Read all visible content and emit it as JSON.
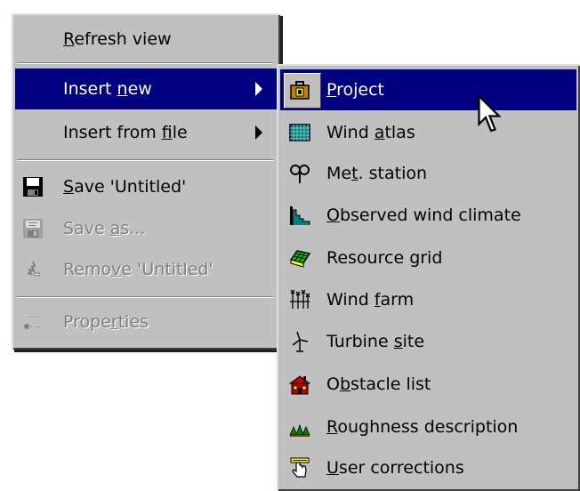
{
  "main_menu": {
    "items": [
      {
        "label_pre": "",
        "label_key": "R",
        "label_post": "efresh view"
      },
      {
        "label_pre": "Insert ",
        "label_key": "n",
        "label_post": "ew"
      },
      {
        "label_pre": "Insert from ",
        "label_key": "f",
        "label_post": "ile"
      },
      {
        "label_pre": "",
        "label_key": "S",
        "label_post": "ave 'Untitled'"
      },
      {
        "label_pre": "Save ",
        "label_key": "a",
        "label_post": "s..."
      },
      {
        "label_pre": "Remo",
        "label_key": "v",
        "label_post": "e 'Untitled'"
      },
      {
        "label_pre": "Prope",
        "label_key": "r",
        "label_post": "ties"
      }
    ]
  },
  "submenu": {
    "items": [
      {
        "label_pre": "",
        "label_key": "P",
        "label_post": "roject"
      },
      {
        "label_pre": "Wind ",
        "label_key": "a",
        "label_post": "tlas"
      },
      {
        "label_pre": "Me",
        "label_key": "t",
        "label_post": ". station"
      },
      {
        "label_pre": "",
        "label_key": "O",
        "label_post": "bserved wind climate"
      },
      {
        "label_pre": "Resource ",
        "label_key": "g",
        "label_post": "rid"
      },
      {
        "label_pre": "Wind ",
        "label_key": "f",
        "label_post": "arm"
      },
      {
        "label_pre": "Turbine ",
        "label_key": "s",
        "label_post": "ite"
      },
      {
        "label_pre": "O",
        "label_key": "b",
        "label_post": "stacle list"
      },
      {
        "label_pre": "",
        "label_key": "R",
        "label_post": "oughness description"
      },
      {
        "label_pre": "",
        "label_key": "U",
        "label_post": "ser corrections"
      }
    ]
  },
  "colors": {
    "menu_face": "#c0c0c0",
    "highlight": "#000080",
    "highlight_text": "#ffffff",
    "disabled_text": "#808080"
  },
  "icons": {
    "save": "floppy-disk-icon",
    "save_as": "save-as-icon",
    "remove": "remove-icon",
    "properties": "properties-icon",
    "project": "briefcase-icon",
    "wind_atlas": "map-grid-icon",
    "met_station": "anemometer-icon",
    "observed_wind": "histogram-icon",
    "resource_grid": "resource-grid-icon",
    "wind_farm": "wind-farm-icon",
    "turbine_site": "turbine-icon",
    "obstacle_list": "house-icon",
    "roughness": "trees-icon",
    "user_corrections": "hand-pointer-icon"
  }
}
